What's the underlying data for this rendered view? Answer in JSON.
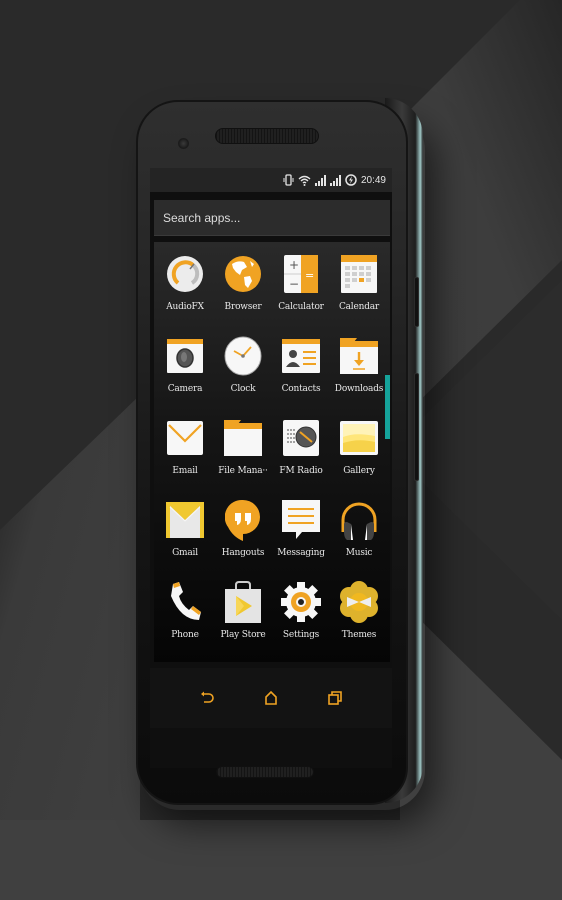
{
  "colors": {
    "accent": "#f0a323",
    "accent_dark": "#d88a10",
    "background": "#2a2a2a",
    "teal": "#15a39a",
    "icon_white": "#f7f7f7"
  },
  "statusbar": {
    "icons": [
      "vibrate-icon",
      "wifi-icon",
      "signal-icon",
      "signal-icon-2",
      "battery-charging-icon"
    ],
    "time": "20:49"
  },
  "search": {
    "placeholder": "Search apps..."
  },
  "apps": [
    {
      "label": "AudioFX",
      "icon": "audiofx-icon"
    },
    {
      "label": "Browser",
      "icon": "globe-icon"
    },
    {
      "label": "Calculator",
      "icon": "calculator-icon"
    },
    {
      "label": "Calendar",
      "icon": "calendar-icon"
    },
    {
      "label": "Camera",
      "icon": "camera-icon"
    },
    {
      "label": "Clock",
      "icon": "clock-icon"
    },
    {
      "label": "Contacts",
      "icon": "contacts-icon"
    },
    {
      "label": "Downloads",
      "icon": "download-folder-icon"
    },
    {
      "label": "Email",
      "icon": "envelope-icon"
    },
    {
      "label": "File Mana··",
      "icon": "folder-icon"
    },
    {
      "label": "FM Radio",
      "icon": "radio-icon"
    },
    {
      "label": "Gallery",
      "icon": "gallery-icon"
    },
    {
      "label": "Gmail",
      "icon": "gmail-icon"
    },
    {
      "label": "Hangouts",
      "icon": "hangouts-icon"
    },
    {
      "label": "Messaging",
      "icon": "message-bubble-icon"
    },
    {
      "label": "Music",
      "icon": "headphones-icon"
    },
    {
      "label": "Phone",
      "icon": "phone-handset-icon"
    },
    {
      "label": "Play Store",
      "icon": "play-store-bag-icon"
    },
    {
      "label": "Settings",
      "icon": "gear-icon"
    },
    {
      "label": "Themes",
      "icon": "themes-flower-icon"
    }
  ],
  "navbar": {
    "back": "back-icon",
    "home": "home-icon",
    "recents": "recents-icon"
  }
}
